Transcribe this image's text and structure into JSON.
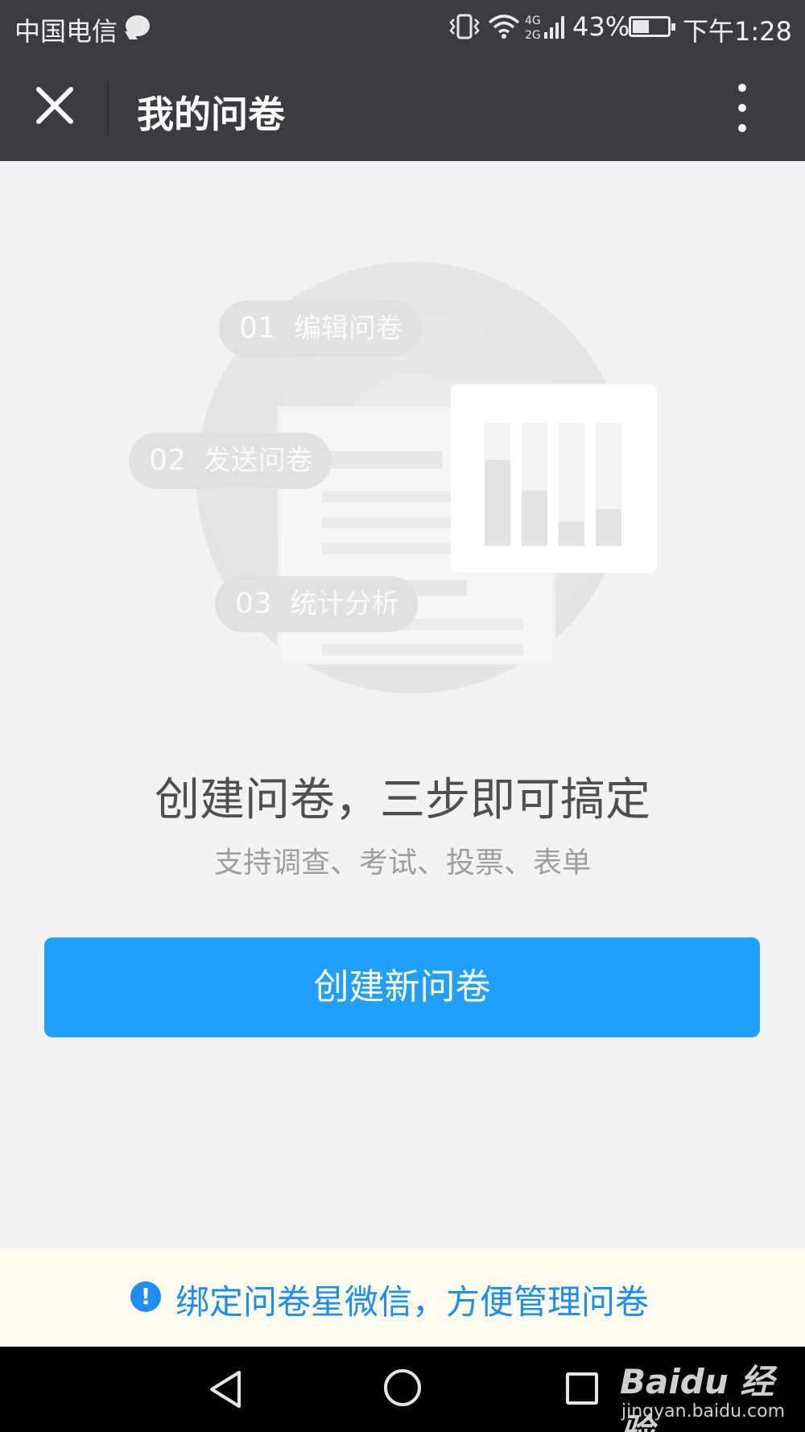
{
  "status_bar": {
    "carrier": "中国电信",
    "battery_percent": "43%",
    "network": "4G 2G",
    "time": "下午1:28"
  },
  "title_bar": {
    "title": "我的问卷"
  },
  "illustration": {
    "steps": [
      {
        "num": "01",
        "label": "编辑问卷"
      },
      {
        "num": "02",
        "label": "发送问卷"
      },
      {
        "num": "03",
        "label": "统计分析"
      }
    ],
    "bar_levels": [
      0.7,
      0.45,
      0.2,
      0.3
    ]
  },
  "empty_state": {
    "headline": "创建问卷，三步即可搞定",
    "subline": "支持调查、考试、投票、表单"
  },
  "actions": {
    "create_label": "创建新问卷"
  },
  "notice": {
    "icon": "!",
    "text": "绑定问卷星微信，方便管理问卷"
  },
  "watermark": {
    "logo": "Baidu 经验",
    "url": "jingyan.baidu.com"
  },
  "colors": {
    "primary": "#20a0fb",
    "notice_text": "#1a8ef1",
    "notice_bg": "#fffbef",
    "header_bg": "#3b3c41",
    "page_bg": "#f2f3f5"
  }
}
